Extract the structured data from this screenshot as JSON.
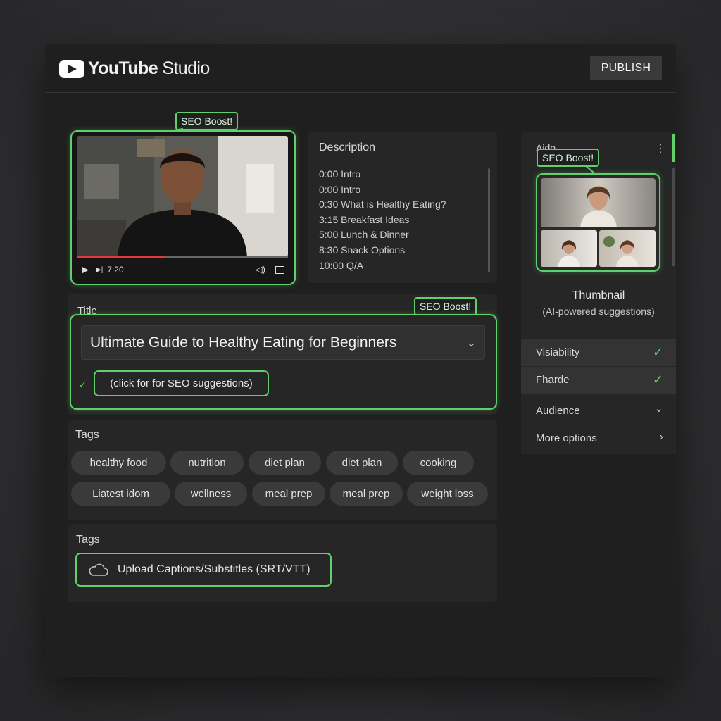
{
  "app": {
    "name_bold": "YouTube",
    "name_light": " Studio",
    "publish_label": "PUBLISH"
  },
  "seo_badge": "SEO Boost!",
  "video": {
    "time": "7:20"
  },
  "description": {
    "heading": "Description",
    "lines": [
      "0:00 Intro",
      "0:00 Intro",
      "0:30 What is Healthy Eating?",
      "3:15 Breakfast Ideas",
      "5:00 Lunch & Dinner",
      "8:30 Snack Options",
      "10:00 Q/A"
    ]
  },
  "title_section": {
    "label": "Title",
    "value": "Ultimate Guide to Healthy Eating for Beginners",
    "suggest_label": "(click for for SEO suggestions)"
  },
  "tags_section": {
    "label": "Tags",
    "tags": [
      "healthy food",
      "nutrition",
      "diet plan",
      "diet plan",
      "cooking",
      "Liatest idom",
      "wellness",
      "meal prep",
      "meal prep",
      "weight loss"
    ]
  },
  "captions_section": {
    "label": "Tags",
    "upload_label": "Upload Captions/Substitles (SRT/VTT)"
  },
  "right_panel": {
    "heading": "Aido",
    "thumbnail_label": "Thumbnail",
    "thumbnail_sub": "(AI-powered suggestions)",
    "options": [
      {
        "label": "Visiability",
        "icon": "check-icon"
      },
      {
        "label": "Fharde",
        "icon": "check-icon"
      },
      {
        "label": "Audience",
        "icon": "chevron-down-icon"
      },
      {
        "label": "More options",
        "icon": "chevron-right-icon"
      }
    ]
  },
  "colors": {
    "accent": "#5fd06a",
    "background": "#1f1f1f",
    "progress": "#e53935"
  }
}
